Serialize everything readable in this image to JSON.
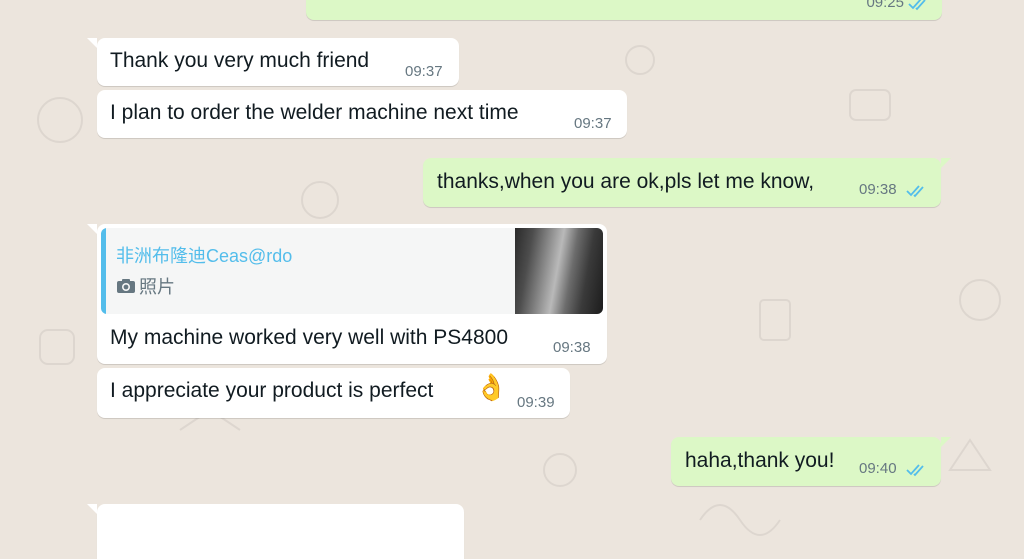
{
  "colors": {
    "background": "#ece5dd",
    "incoming_bubble": "#ffffff",
    "outgoing_bubble": "#dcf8c6",
    "read_ticks": "#53bdeb",
    "quote_accent": "#53bdeb"
  },
  "messages": [
    {
      "direction": "outgoing",
      "text": "",
      "time": "09:25",
      "status": "read"
    },
    {
      "direction": "incoming",
      "text": "Thank you very much friend",
      "time": "09:37"
    },
    {
      "direction": "incoming",
      "text": "I plan to order the welder machine next time",
      "time": "09:37"
    },
    {
      "direction": "outgoing",
      "text": "thanks,when you are ok,pls let me know,",
      "time": "09:38",
      "status": "read"
    },
    {
      "direction": "incoming",
      "quote": {
        "author": "非洲布隆迪Ceas@rdo",
        "type_icon": "camera-icon",
        "type_label": "照片",
        "has_thumbnail": true
      },
      "text": "My machine worked very well with PS4800",
      "time": "09:38"
    },
    {
      "direction": "incoming",
      "text": "I appreciate your product is perfect",
      "emoji": "👌",
      "time": "09:39"
    },
    {
      "direction": "outgoing",
      "text": "haha,thank you!",
      "time": "09:40",
      "status": "read"
    },
    {
      "direction": "incoming",
      "text": "",
      "time": ""
    }
  ]
}
